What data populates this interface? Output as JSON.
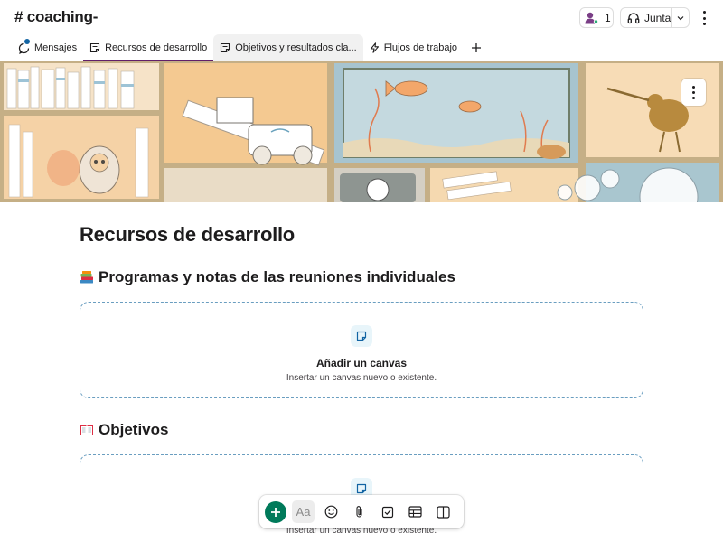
{
  "header": {
    "channel_title": "# coaching-",
    "member_count": "1",
    "huddle_label": "Junta"
  },
  "tabs": [
    {
      "label": "Mensajes"
    },
    {
      "label": "Recursos de desarrollo"
    },
    {
      "label": "Objetivos y resultados cla..."
    },
    {
      "label": "Flujos de trabajo"
    }
  ],
  "page": {
    "title": "Recursos de desarrollo",
    "sections": [
      {
        "heading": "Programas y notas de las reuniones individuales",
        "emoji": "books-emoji"
      },
      {
        "heading": "Objetivos",
        "emoji": "open-book-emoji"
      }
    ],
    "canvas_prompt": {
      "title": "Añadir un canvas",
      "subtitle": "Insertar un canvas nuevo o existente."
    }
  },
  "colors": {
    "accent": "#611f69",
    "primary_green": "#007a5a",
    "dashed_border": "#6a9ec0"
  },
  "toolbar": {
    "aa_label": "Aa",
    "icons": [
      "plus-icon",
      "text-format-icon",
      "emoji-icon",
      "attach-icon",
      "checkbox-icon",
      "table-icon",
      "columns-icon"
    ]
  }
}
